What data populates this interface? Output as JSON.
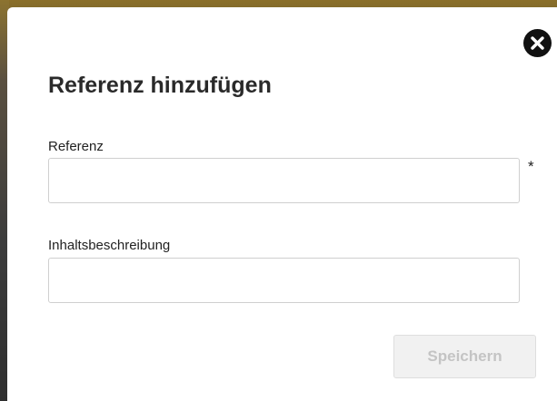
{
  "dialog": {
    "title": "Referenz hinzufügen",
    "close_icon": "close-circle-icon",
    "fields": {
      "reference": {
        "label": "Referenz",
        "value": "",
        "placeholder": "",
        "required_marker": "*"
      },
      "description": {
        "label": "Inhaltsbeschreibung",
        "value": "",
        "placeholder": ""
      }
    },
    "save_label": "Speichern",
    "save_disabled": true
  },
  "colors": {
    "modal_background": "#ffffff",
    "title_text": "#2a2a2a",
    "close_button": "#111111",
    "input_border": "#cfcfcf",
    "disabled_button_bg": "#f1f1f1",
    "disabled_button_text": "#c4c4c4",
    "backdrop_top": "#8a6f2a"
  }
}
